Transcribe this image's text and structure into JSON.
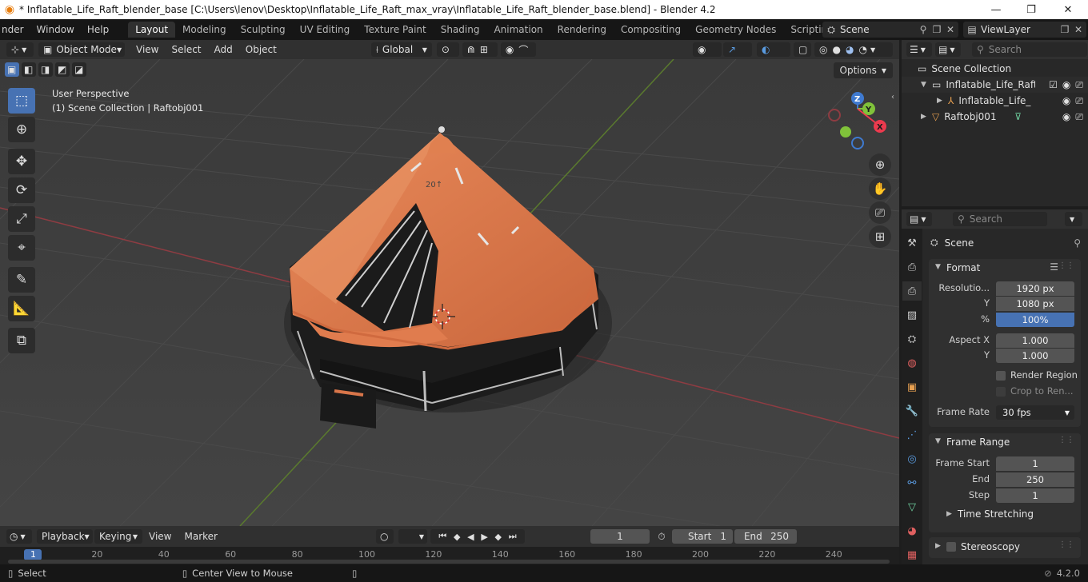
{
  "window": {
    "title": "* Inflatable_Life_Raft_blender_base [C:\\Users\\lenov\\Desktop\\Inflatable_Life_Raft_max_vray\\Inflatable_Life_Raft_blender_base.blend] - Blender 4.2",
    "minimize_glyph": "—",
    "maximize_glyph": "❐",
    "close_glyph": "✕"
  },
  "menus": [
    "nder",
    "Window",
    "Help"
  ],
  "workspaces": [
    "Layout",
    "Modeling",
    "Sculpting",
    "UV Editing",
    "Texture Paint",
    "Shading",
    "Animation",
    "Rendering",
    "Compositing",
    "Geometry Nodes",
    "Scripting"
  ],
  "add_workspace": "+",
  "scene_selector": "Scene",
  "viewlayer_selector": "ViewLayer",
  "viewport_header": {
    "mode": "Object Mode",
    "menus": [
      "View",
      "Select",
      "Add",
      "Object"
    ],
    "transform_orientation": "Global",
    "options_label": "Options"
  },
  "viewport": {
    "perspective_label": "User Perspective",
    "collection_label": "(1) Scene Collection | Raftobj001",
    "raft_text": "20↑",
    "gizmo": {
      "z": "Z",
      "y": "Y",
      "x": "X"
    }
  },
  "outliner": {
    "search_placeholder": "Search",
    "rows": [
      {
        "label": "Scene Collection"
      },
      {
        "label": "Inflatable_Life_Raft"
      },
      {
        "label": "Inflatable_Life_"
      },
      {
        "label": "Raftobj001"
      }
    ]
  },
  "properties": {
    "search_placeholder": "Search",
    "context": "Scene",
    "format": {
      "title": "Format",
      "resolution_x_label": "Resolutio...",
      "resolution_x": "1920 px",
      "resolution_y_label": "Y",
      "resolution_y": "1080 px",
      "percent_label": "%",
      "percent": "100%",
      "aspect_x_label": "Aspect X",
      "aspect_x": "1.000",
      "aspect_y_label": "Y",
      "aspect_y": "1.000",
      "render_region": "Render Region",
      "crop": "Crop to Ren...",
      "frame_rate_label": "Frame Rate",
      "frame_rate": "30 fps"
    },
    "frame_range": {
      "title": "Frame Range",
      "start_label": "Frame Start",
      "start": "1",
      "end_label": "End",
      "end": "250",
      "step_label": "Step",
      "step": "1",
      "time_stretching": "Time Stretching"
    },
    "stereoscopy": "Stereoscopy"
  },
  "timeline": {
    "menus": [
      "Playback",
      "Keying",
      "View",
      "Marker"
    ],
    "current_frame": "1",
    "start_label": "Start",
    "start": "1",
    "end_label": "End",
    "end": "250",
    "ruler_labels": [
      "1",
      "20",
      "40",
      "60",
      "80",
      "100",
      "120",
      "140",
      "160",
      "180",
      "200",
      "220",
      "240"
    ]
  },
  "statusbar": {
    "select": "Select",
    "center_view": "Center View to Mouse",
    "version": "4.2.0"
  },
  "colors": {
    "accent_blue": "#4772b3",
    "raft_orange": "#d9764a",
    "x_axis": "#ec3a4e",
    "y_axis": "#80c23a",
    "z_axis": "#3f7ad0"
  }
}
